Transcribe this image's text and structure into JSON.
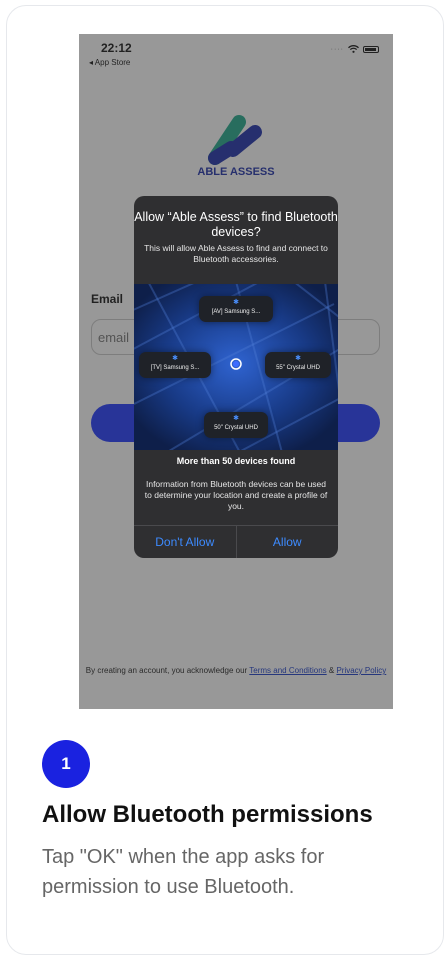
{
  "status_bar": {
    "time": "22:12",
    "back_label": "◂ App Store"
  },
  "app": {
    "brand": "ABLE ASSESS",
    "email_label": "Email",
    "email_placeholder": "email",
    "legal_prefix": "By creating an account, you acknowledge our ",
    "terms_link": "Terms and Conditions",
    "legal_mid": " & ",
    "privacy_link": "Privacy Policy"
  },
  "dialog": {
    "title": "Allow “Able Assess” to find Bluetooth devices?",
    "subtitle": "This will allow Able Assess to find and connect to Bluetooth accessories.",
    "devices": [
      {
        "name": "[AV] Samsung S..."
      },
      {
        "name": "[TV] Samsung S..."
      },
      {
        "name": "55\" Crystal UHD"
      },
      {
        "name": "50\" Crystal UHD"
      }
    ],
    "found_text": "More than 50 devices found",
    "info_text": "Information from Bluetooth devices can be used to determine your location and create a profile of you.",
    "deny_label": "Don't Allow",
    "allow_label": "Allow"
  },
  "step": {
    "number": "1",
    "title": "Allow Bluetooth permissions",
    "description": "Tap \"OK\" when the app asks for permission to use Bluetooth."
  },
  "colors": {
    "accent": "#1a22e0",
    "brand": "#1a2ca8",
    "dialog_link": "#3d8bff"
  }
}
